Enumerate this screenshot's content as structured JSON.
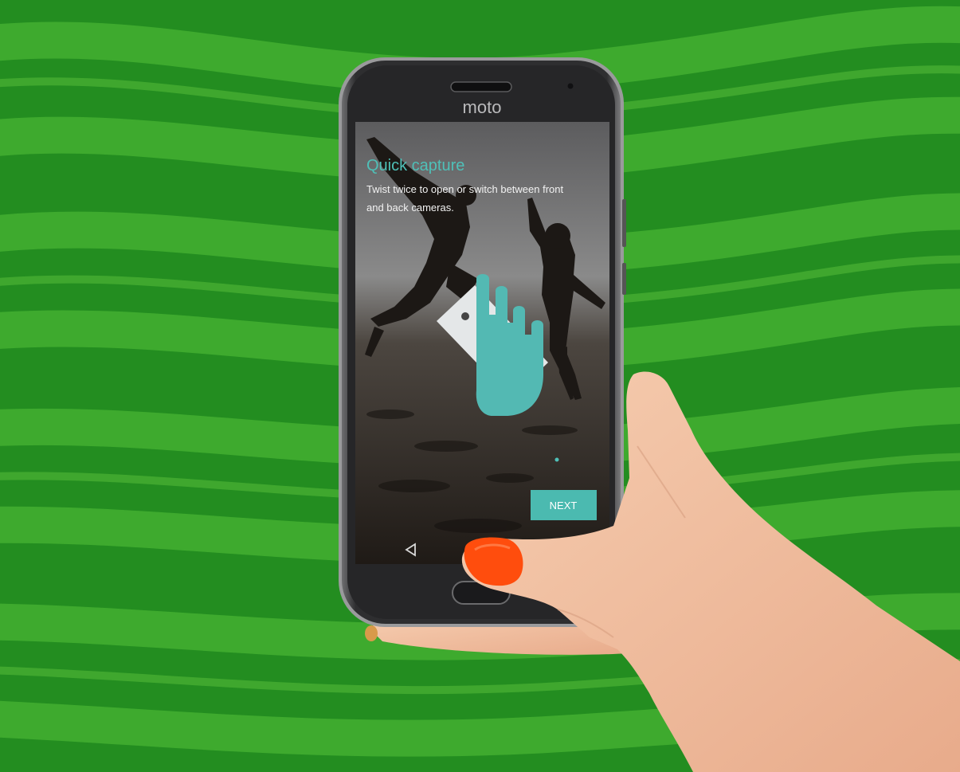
{
  "phone": {
    "brand": "moto",
    "screen": {
      "title": "Quick capture",
      "description_line1": "Twist twice to open or switch between front",
      "description_line2": "and back cameras.",
      "next_label": "NEXT",
      "page_indicator": {
        "total": 1,
        "active": 0
      }
    }
  },
  "colors": {
    "background_light": "#3ea82d",
    "background_dark": "#228c1f",
    "accent": "#4bbab0",
    "nail": "#ff4d0d",
    "skin": "#f2c3a4",
    "phone_body": "#2c2c2e"
  }
}
